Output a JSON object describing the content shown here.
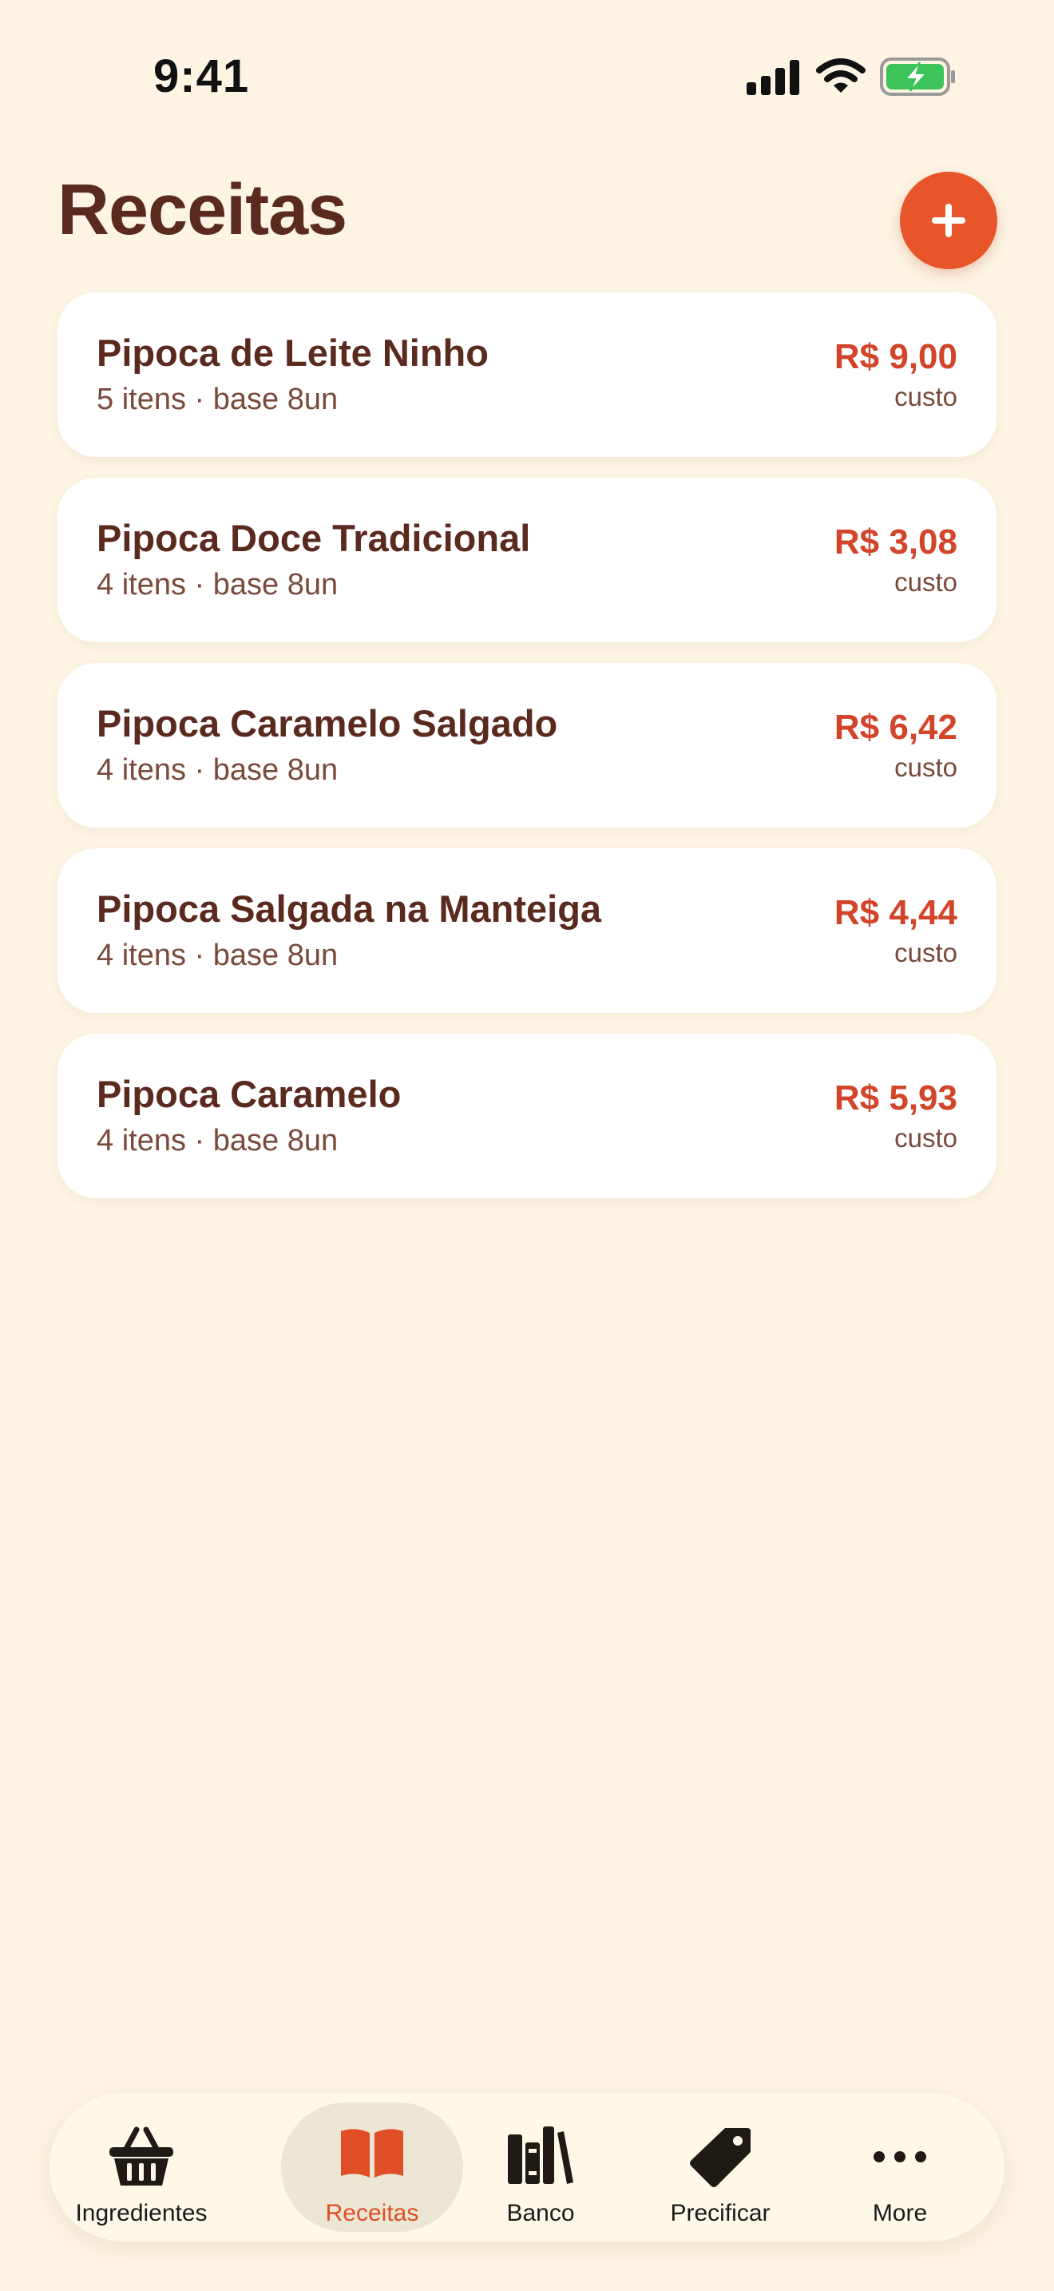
{
  "status_bar": {
    "time": "9:41",
    "icons": [
      "signal-icon",
      "wifi-icon",
      "battery-charging-icon"
    ]
  },
  "header": {
    "title": "Receitas",
    "add_icon": "plus-icon"
  },
  "recipes": [
    {
      "name": "Pipoca de Leite Ninho",
      "meta": "5 itens · base 8un",
      "price": "R$ 9,00",
      "price_caption": "custo"
    },
    {
      "name": "Pipoca Doce Tradicional",
      "meta": "4 itens · base 8un",
      "price": "R$ 3,08",
      "price_caption": "custo"
    },
    {
      "name": "Pipoca Caramelo Salgado",
      "meta": "4 itens · base 8un",
      "price": "R$ 6,42",
      "price_caption": "custo"
    },
    {
      "name": "Pipoca Salgada na Manteiga",
      "meta": "4 itens · base 8un",
      "price": "R$ 4,44",
      "price_caption": "custo"
    },
    {
      "name": "Pipoca Caramelo",
      "meta": "4 itens · base 8un",
      "price": "R$ 5,93",
      "price_caption": "custo"
    }
  ],
  "tab_bar": {
    "active": "Receitas",
    "tabs": [
      {
        "label": "Ingredientes",
        "icon": "basket-icon"
      },
      {
        "label": "Receitas",
        "icon": "book-icon"
      },
      {
        "label": "Banco",
        "icon": "books-icon"
      },
      {
        "label": "Precificar",
        "icon": "tag-icon"
      },
      {
        "label": "More",
        "icon": "more-icon"
      }
    ]
  },
  "colors": {
    "background": "#fdf4e4",
    "title": "#5b2a1f",
    "accent": "#e9552b",
    "price": "#d2452a",
    "battery": "#3cc45b"
  }
}
